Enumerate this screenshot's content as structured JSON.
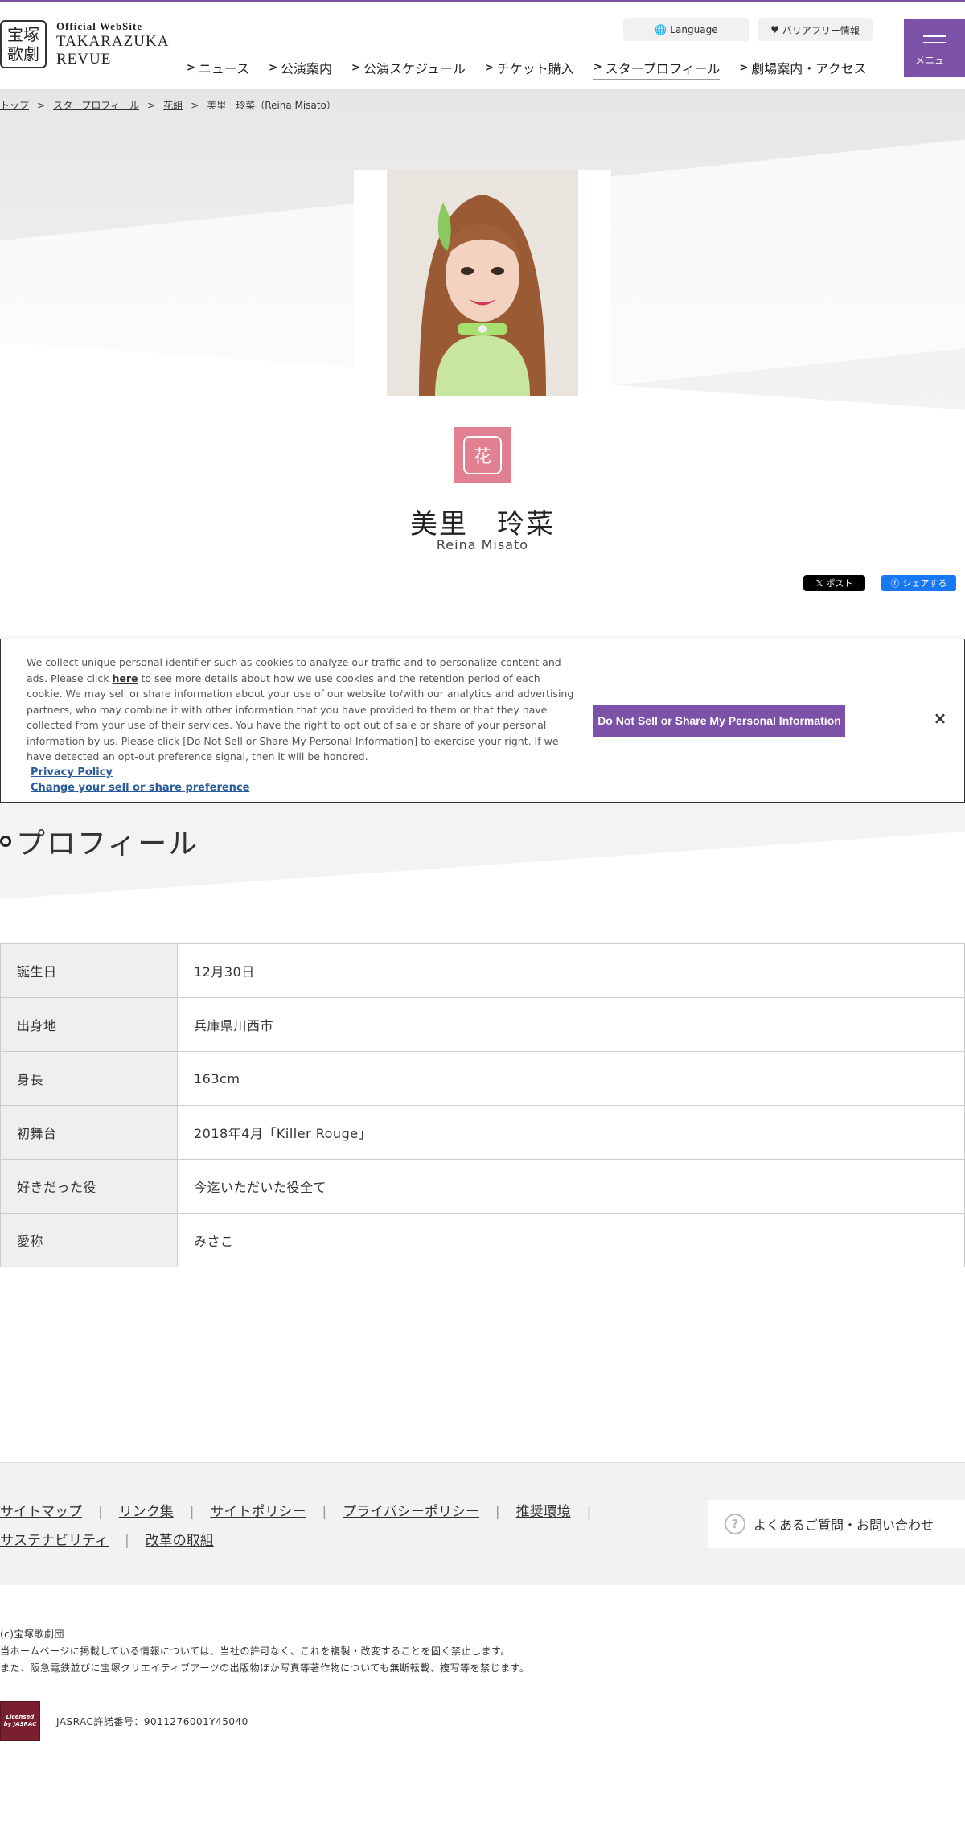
{
  "header": {
    "logo_seal": "宝塚\n歌劇",
    "logo_small": "Official WebSite",
    "logo_line1": "TAKARAZUKA",
    "logo_line2": "REVUE",
    "language_label": "Language",
    "barrier_free_label": "バリアフリー情報",
    "menu_label": "メニュー",
    "nav": [
      "ニュース",
      "公演案内",
      "公演スケジュール",
      "チケット購入",
      "スタープロフィール",
      "劇場案内・アクセス"
    ]
  },
  "breadcrumb": {
    "items": [
      "トップ",
      "スタープロフィール",
      "花組"
    ],
    "current": "美里　玲菜（Reina Misato）",
    "separator": ">"
  },
  "profile_card": {
    "troupe_icon_char": "花",
    "name_jp": "美里　玲菜",
    "name_en": "Reina Misato",
    "share_x": "ポスト",
    "share_fb": "シェアする",
    "accent_color": "#e08090"
  },
  "cookie_banner": {
    "text_part1": "We collect unique personal identifier such as cookies to analyze our traffic and to personalize content and ads. Please click ",
    "here": "here",
    "text_part2": " to see more details about how we use cookies and the retention period of each cookie. We may sell or share information about your use of our website to/with our analytics and advertising partners, who may combine it with other information that you have provided to them or that they have collected from your use of their services. You have the right to opt out of sale or share of your personal information by us. Please click [Do Not Sell or Share My Personal Information] to exercise your right. If we have detected an opt-out preference signal, then it will be honored.",
    "privacy_link": "Privacy Policy",
    "preference_link": "Change your sell or share preference",
    "button_label": "Do Not Sell or Share My Personal Information",
    "close_label": "×"
  },
  "profile": {
    "heading": "プロフィール",
    "rows": [
      {
        "label": "誕生日",
        "value": "12月30日"
      },
      {
        "label": "出身地",
        "value": "兵庫県川西市"
      },
      {
        "label": "身長",
        "value": "163cm"
      },
      {
        "label": "初舞台",
        "value": "2018年4月「Killer Rouge」"
      },
      {
        "label": "好きだった役",
        "value": "今迄いただいた役全て"
      },
      {
        "label": "愛称",
        "value": "みさこ"
      }
    ]
  },
  "footer": {
    "links_row1": [
      "サイトマップ",
      "リンク集",
      "サイトポリシー",
      "プライバシーポリシー",
      "推奨環境"
    ],
    "links_row2": [
      "サステナビリティ",
      "改革の取組"
    ],
    "faq_label": "よくあるご質問・お問い合わせ",
    "copyright_lines": [
      "(c)宝塚歌劇団",
      "当ホームページに掲載している情報については、当社の許可なく、これを複製・改変することを固く禁止します。",
      "また、阪急電鉄並びに宝塚クリエイティブアーツの出版物ほか写真等著作物についても無断転載、複写等を禁じます。"
    ],
    "jasrac_logo": "Licensed by JASRAC",
    "jasrac_number": "JASRAC許諾番号：9011276001Y45040"
  },
  "colors": {
    "brand": "#7b52a8",
    "troupe": "#e08090"
  }
}
